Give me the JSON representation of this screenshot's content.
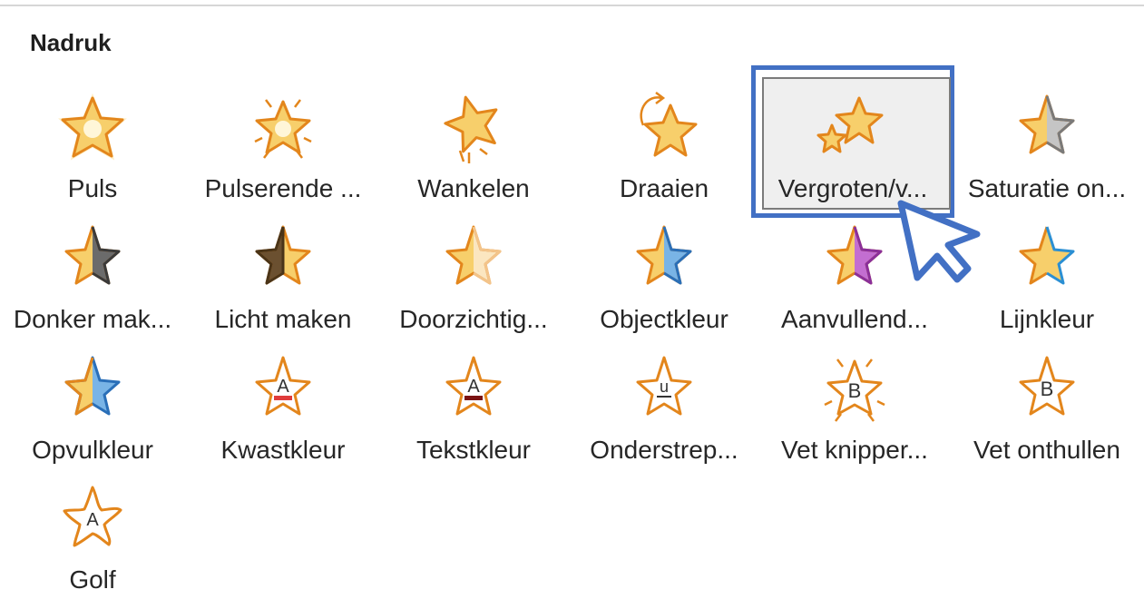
{
  "section": {
    "title": "Nadruk"
  },
  "effects": [
    {
      "label": "Puls",
      "icon": "star-pulse-icon"
    },
    {
      "label": "Pulserende ...",
      "icon": "star-pulse-rays-icon"
    },
    {
      "label": "Wankelen",
      "icon": "star-teeter-icon"
    },
    {
      "label": "Draaien",
      "icon": "star-spin-icon"
    },
    {
      "label": "Vergroten/v...",
      "icon": "star-grow-shrink-icon",
      "selected": true
    },
    {
      "label": "Saturatie on...",
      "icon": "star-desaturate-icon"
    },
    {
      "label": "Donker mak...",
      "icon": "star-darken-icon"
    },
    {
      "label": "Licht maken",
      "icon": "star-lighten-icon"
    },
    {
      "label": "Doorzichtig...",
      "icon": "star-transparency-icon"
    },
    {
      "label": "Objectkleur",
      "icon": "star-object-color-icon"
    },
    {
      "label": "Aanvullend...",
      "icon": "star-complementary-color-icon"
    },
    {
      "label": "Lijnkleur",
      "icon": "star-line-color-icon"
    },
    {
      "label": "Opvulkleur",
      "icon": "star-fill-color-icon"
    },
    {
      "label": "Kwastkleur",
      "icon": "star-brush-color-icon"
    },
    {
      "label": "Tekstkleur",
      "icon": "star-font-color-icon"
    },
    {
      "label": "Onderstrep...",
      "icon": "star-underline-icon"
    },
    {
      "label": "Vet knipper...",
      "icon": "star-bold-flash-icon"
    },
    {
      "label": "Vet onthullen",
      "icon": "star-bold-reveal-icon"
    },
    {
      "label": "Golf",
      "icon": "star-wave-icon"
    }
  ],
  "colors": {
    "star_fill": "#f7cf6b",
    "star_stroke": "#e3861c",
    "selection_outline": "#4270c4"
  }
}
